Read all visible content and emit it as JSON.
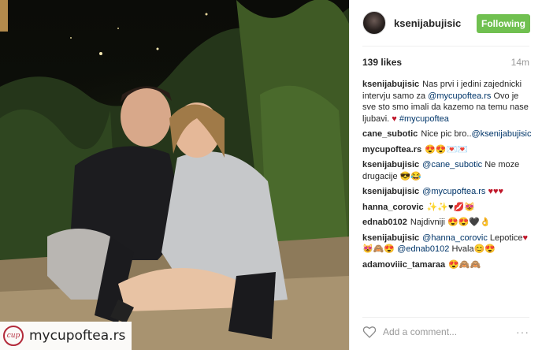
{
  "post": {
    "username": "ksenijabujisic",
    "follow_label": "Following",
    "likes": "139 likes",
    "time_ago": "14m",
    "comment_placeholder": "Add a comment...",
    "more_label": "···",
    "watermark": "mycupoftea.rs"
  },
  "comments": [
    {
      "user": "ksenijabujisic",
      "parts": [
        {
          "text": "Nas prvi i jedini zajednicki intervju samo za "
        },
        {
          "text": "@mycupoftea.rs",
          "tag": true
        },
        {
          "text": " Ovo je sve sto smo imali da kazemo na temu nase ljubavi. "
        },
        {
          "text": "♥",
          "heart": true
        },
        {
          "text": " "
        },
        {
          "text": "#mycupoftea",
          "tag": true
        }
      ]
    },
    {
      "user": "cane_subotic",
      "parts": [
        {
          "text": "Nice pic bro.."
        },
        {
          "text": "@ksenijabujisic",
          "tag": true
        }
      ]
    },
    {
      "user": "mycupoftea.rs",
      "parts": [
        {
          "text": "😍😍💌💌"
        }
      ]
    },
    {
      "user": "ksenijabujisic",
      "parts": [
        {
          "text": "@cane_subotic",
          "tag": true
        },
        {
          "text": " Ne moze drugacije 😎😂"
        }
      ]
    },
    {
      "user": "ksenijabujisic",
      "parts": [
        {
          "text": "@mycupoftea.rs",
          "tag": true
        },
        {
          "text": " "
        },
        {
          "text": "♥♥♥",
          "heart": true
        }
      ]
    },
    {
      "user": "hanna_corovic",
      "parts": [
        {
          "text": "✨✨♥💋😻"
        }
      ]
    },
    {
      "user": "ednab0102",
      "parts": [
        {
          "text": "Najdivniji 😍😍🖤👌"
        }
      ]
    },
    {
      "user": "ksenijabujisic",
      "parts": [
        {
          "text": "@hanna_corovic",
          "tag": true
        },
        {
          "text": " Lepotice"
        },
        {
          "text": "♥",
          "heart": true
        },
        {
          "text": " 😻🙈😍 "
        },
        {
          "text": "@ednab0102",
          "tag": true
        },
        {
          "text": " Hvala😊😍"
        }
      ]
    },
    {
      "user": "adamoviiic_tamaraa",
      "parts": [
        {
          "text": "😍🙈🙈"
        }
      ]
    }
  ],
  "colors": {
    "follow_bg": "#70c050",
    "link": "#003569",
    "heart": "#c0182b",
    "watermark_accent": "#b32a3a"
  },
  "icons": {
    "like": "heart-outline-icon",
    "more": "more-dots-icon",
    "watermark_logo": "cup-logo-icon"
  }
}
